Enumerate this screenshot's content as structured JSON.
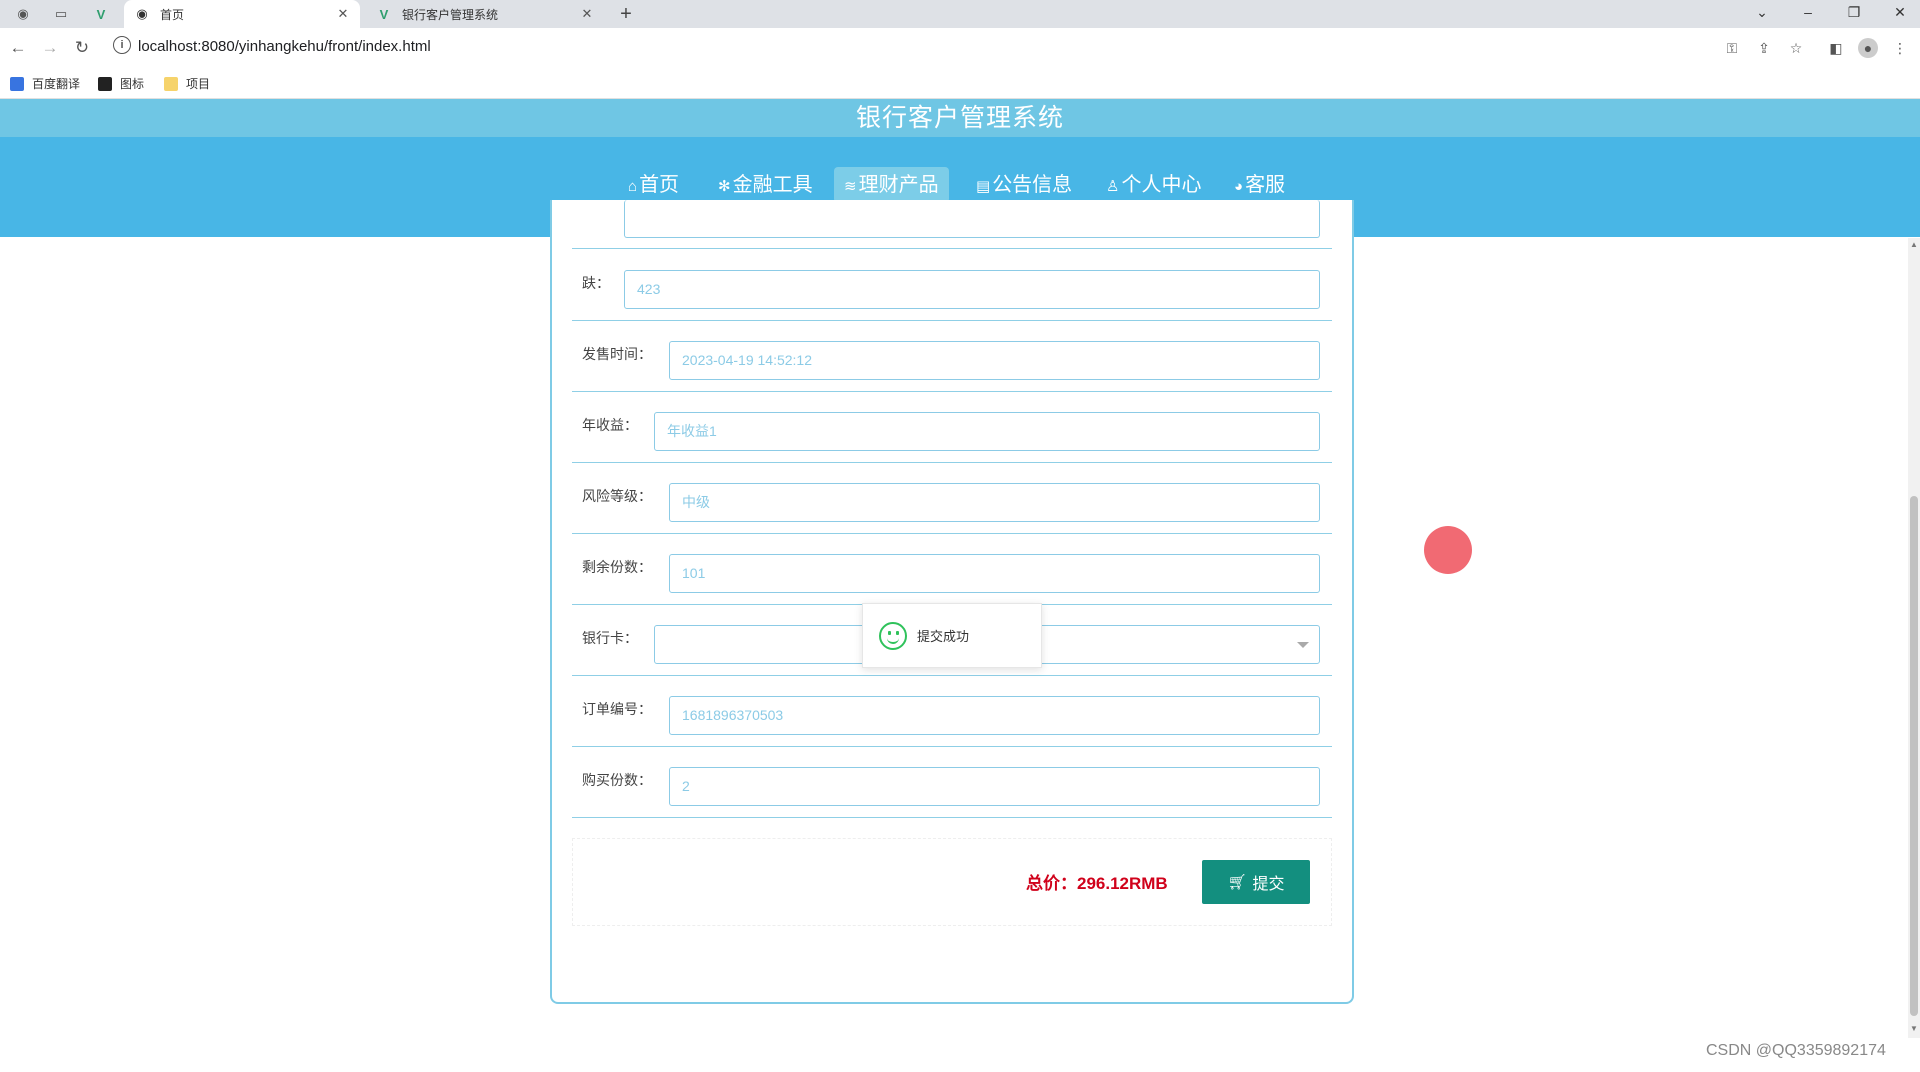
{
  "browser": {
    "tabs": [
      {
        "title": "首页",
        "active": true
      },
      {
        "title": "银行客户管理系统",
        "active": false
      }
    ],
    "url": "localhost:8080/yinhangkehu/front/index.html",
    "bookmarks": [
      "百度翻译",
      "图标",
      "项目"
    ]
  },
  "site": {
    "title": "银行客户管理系统",
    "nav": [
      "首页",
      "金融工具",
      "理财产品",
      "公告信息",
      "个人中心",
      "客服"
    ],
    "active_nav": "理财产品"
  },
  "form": {
    "fields": [
      {
        "label": "趺：",
        "value": "423"
      },
      {
        "label": "发售时间：",
        "value": "2023-04-19 14:52:12"
      },
      {
        "label": "年收益：",
        "value": "年收益1"
      },
      {
        "label": "风险等级：",
        "value": "中级"
      },
      {
        "label": "剩余份数：",
        "value": "101"
      },
      {
        "label": "银行卡：",
        "value": ""
      },
      {
        "label": "订单编号：",
        "value": "1681896370503"
      },
      {
        "label": "购买份数：",
        "value": "2"
      }
    ],
    "total": "总价：296.12RMB",
    "submit_label": "提交"
  },
  "toast": {
    "message": "提交成功"
  },
  "watermark": "CSDN @QQ3359892174",
  "colors": {
    "header_bg": "#48b6e6",
    "title_bg": "#6fc6e4",
    "submit": "#138f7f",
    "total": "#d0021b"
  }
}
